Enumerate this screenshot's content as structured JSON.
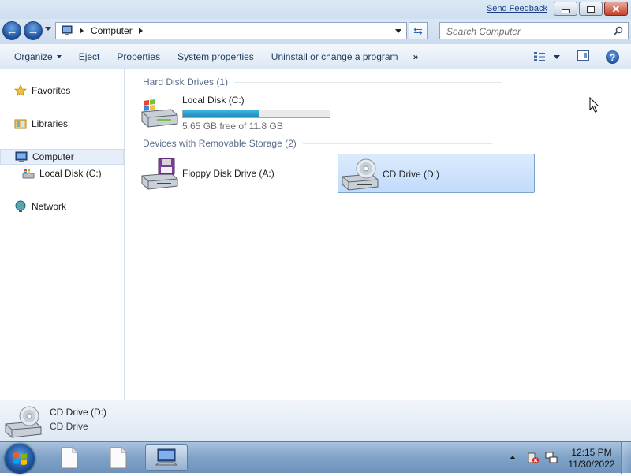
{
  "window": {
    "send_feedback": "Send Feedback",
    "minimize_icon": "minimize-icon",
    "maximize_icon": "restore-icon",
    "close_icon": "close-icon"
  },
  "address_bar": {
    "location": "Computer",
    "search_placeholder": "Search Computer"
  },
  "command_bar": {
    "items": [
      "Organize",
      "Eject",
      "Properties",
      "System properties",
      "Uninstall or change a program"
    ],
    "more": "»"
  },
  "nav_pane": {
    "favorites": "Favorites",
    "libraries": "Libraries",
    "computer": "Computer",
    "local_disk": "Local Disk (C:)",
    "network": "Network"
  },
  "content": {
    "groups": [
      {
        "header": "Hard Disk Drives (1)",
        "items": [
          {
            "name": "Local Disk (C:)",
            "free_text": "5.65 GB free of 11.8 GB",
            "used_fraction": 0.52,
            "icon": "hard-disk-icon"
          }
        ]
      },
      {
        "header": "Devices with Removable Storage (2)",
        "items": [
          {
            "name": "Floppy Disk Drive (A:)",
            "icon": "floppy-drive-icon"
          },
          {
            "name": "CD Drive (D:)",
            "icon": "cd-drive-icon",
            "selected": true
          }
        ]
      }
    ]
  },
  "details_pane": {
    "name": "CD Drive (D:)",
    "type": "CD Drive"
  },
  "taskbar": {
    "time": "12:15 PM",
    "date": "11/30/2022"
  },
  "colors": {
    "selection_fill": "#c1dbfc",
    "progress_fill": "#1c89b9",
    "group_header": "#5a6d8a",
    "link": "#1a3d84"
  }
}
